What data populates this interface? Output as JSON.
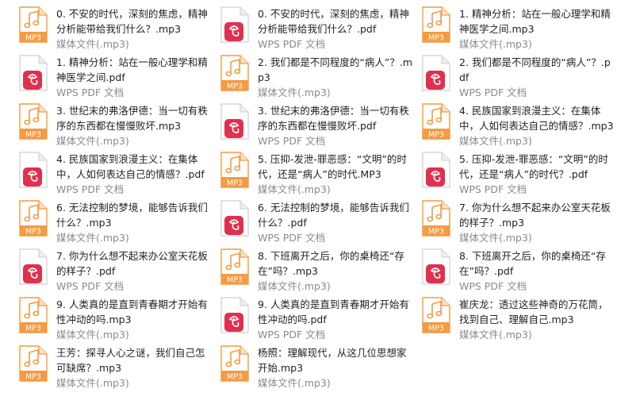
{
  "colors": {
    "mp3_accent": "#f49b43",
    "pdf_accent": "#e0304f",
    "text": "#222222",
    "subtext": "#8a8a8a"
  },
  "files": [
    {
      "name": "0. 不安的时代，深刻的焦虑，精神分析能带给我们什么？.mp3",
      "type": "媒体文件(.mp3)",
      "kind": "mp3",
      "icon_label": "MP3"
    },
    {
      "name": "0. 不安的时代，深刻的焦虑，精神分析能带给我们什么？.pdf",
      "type": "WPS PDF 文档",
      "kind": "pdf"
    },
    {
      "name": "1. 精神分析：站在一般心理学和精神医学之间.mp3",
      "type": "媒体文件(.mp3)",
      "kind": "mp3",
      "icon_label": "MP3"
    },
    {
      "name": "1. 精神分析：站在一般心理学和精神医学之间.pdf",
      "type": "WPS PDF 文档",
      "kind": "pdf"
    },
    {
      "name": "2. 我们都是不同程度的“病人”？.mp3",
      "type": "媒体文件(.mp3)",
      "kind": "mp3",
      "icon_label": "MP3"
    },
    {
      "name": "2. 我们都是不同程度的“病人”？.pdf",
      "type": "WPS PDF 文档",
      "kind": "pdf"
    },
    {
      "name": "3. 世纪末的弗洛伊德：当一切有秩序的东西都在慢慢败坏.mp3",
      "type": "媒体文件(.mp3)",
      "kind": "mp3",
      "icon_label": "MP3"
    },
    {
      "name": "3. 世纪末的弗洛伊德：当一切有秩序的东西都在慢慢败坏.pdf",
      "type": "WPS PDF 文档",
      "kind": "pdf"
    },
    {
      "name": "4. 民族国家到浪漫主义：在集体中，人如何表达自己的情感？.mp3",
      "type": "媒体文件(.mp3)",
      "kind": "mp3",
      "icon_label": "MP3"
    },
    {
      "name": "4. 民族国家到浪漫主义：在集体中，人如何表达自己的情感？.pdf",
      "type": "WPS PDF 文档",
      "kind": "pdf"
    },
    {
      "name": "5. 压抑-发泄-罪恶感：“文明”的时代，还是“病人”的时代.MP3",
      "type": "媒体文件(.mp3)",
      "kind": "mp3",
      "icon_label": "MP3"
    },
    {
      "name": "5. 压抑-发泄-罪恶感：“文明”的时代，还是“病人”的时代？.pdf",
      "type": "WPS PDF 文档",
      "kind": "pdf"
    },
    {
      "name": "6. 无法控制的梦境，能够告诉我们什么？.mp3",
      "type": "媒体文件(.mp3)",
      "kind": "mp3",
      "icon_label": "MP3"
    },
    {
      "name": "6. 无法控制的梦境，能够告诉我们什么？.pdf",
      "type": "WPS PDF 文档",
      "kind": "pdf"
    },
    {
      "name": "7. 你为什么想不起来办公室天花板的样子？.mp3",
      "type": "媒体文件(.mp3)",
      "kind": "mp3",
      "icon_label": "MP3"
    },
    {
      "name": "7. 你为什么想不起来办公室天花板的样子？.pdf",
      "type": "WPS PDF 文档",
      "kind": "pdf"
    },
    {
      "name": "8. 下班离开之后，你的桌椅还“存在”吗？.mp3",
      "type": "媒体文件(.mp3)",
      "kind": "mp3",
      "icon_label": "MP3"
    },
    {
      "name": "8. 下班离开之后，你的桌椅还“存在”吗？.pdf",
      "type": "WPS PDF 文档",
      "kind": "pdf"
    },
    {
      "name": "9. 人类真的是直到青春期才开始有性冲动的吗.mp3",
      "type": "媒体文件(.mp3)",
      "kind": "mp3",
      "icon_label": "MP3"
    },
    {
      "name": "9. 人类真的是直到青春期才开始有性冲动的吗.pdf",
      "type": "WPS PDF 文档",
      "kind": "pdf"
    },
    {
      "name": "崔庆龙：透过这些神奇的万花筒，找到自己、理解自己.mp3",
      "type": "媒体文件(.mp3)",
      "kind": "mp3",
      "icon_label": "MP3"
    },
    {
      "name": "王芳：探寻人心之谜，我们自己怎可缺席？.mp3",
      "type": "媒体文件(.mp3)",
      "kind": "mp3",
      "icon_label": "MP3"
    },
    {
      "name": "杨照：理解现代，从这几位思想家开始.mp3",
      "type": "媒体文件(.mp3)",
      "kind": "mp3",
      "icon_label": "MP3"
    }
  ]
}
